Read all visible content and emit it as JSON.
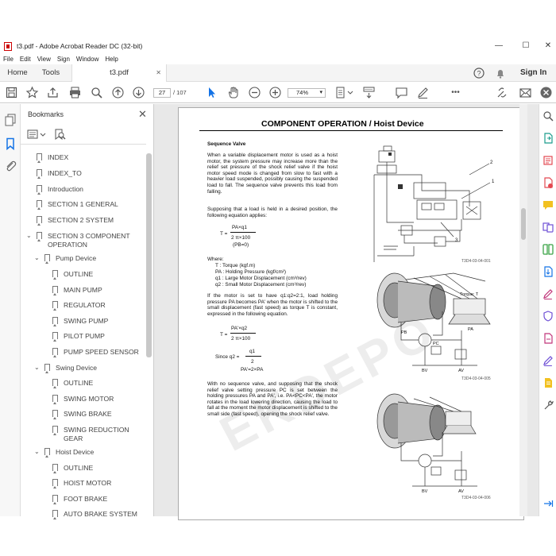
{
  "window": {
    "title": "t3.pdf - Adobe Acrobat Reader DC (32-bit)",
    "minimize": "—",
    "maximize": "☐",
    "close": "✕"
  },
  "menu": [
    "File",
    "Edit",
    "View",
    "Sign",
    "Window",
    "Help"
  ],
  "tabs": {
    "home": "Home",
    "tools": "Tools",
    "doc": "t3.pdf",
    "doc_close": "✕",
    "sign_in": "Sign In"
  },
  "toolbar": {
    "page_current": "27",
    "page_total": "/ 107",
    "zoom": "74%"
  },
  "bookmarks": {
    "header": "Bookmarks",
    "close": "✕",
    "items": [
      {
        "label": "INDEX"
      },
      {
        "label": "INDEX_TO"
      },
      {
        "label": "Introduction"
      },
      {
        "label": "SECTION 1 GENERAL"
      },
      {
        "label": "SECTION 2 SYSTEM"
      },
      {
        "label": "SECTION 3 COMPONENT"
      },
      {
        "label": "OPERATION"
      },
      {
        "label": "Pump Device"
      },
      {
        "label": "OUTLINE"
      },
      {
        "label": "MAIN PUMP"
      },
      {
        "label": "REGULATOR"
      },
      {
        "label": "SWING PUMP"
      },
      {
        "label": "PILOT PUMP"
      },
      {
        "label": "PUMP SPEED SENSOR"
      },
      {
        "label": "Swing Device"
      },
      {
        "label": "OUTLINE"
      },
      {
        "label": "SWING MOTOR"
      },
      {
        "label": "SWING BRAKE"
      },
      {
        "label": "SWING REDUCTION"
      },
      {
        "label": "GEAR"
      },
      {
        "label": "Hoist Device"
      },
      {
        "label": "OUTLINE"
      },
      {
        "label": "HOIST MOTOR"
      },
      {
        "label": "FOOT BRAKE"
      },
      {
        "label": "AUTO BRAKE SYSTEM"
      }
    ]
  },
  "document": {
    "title": "COMPONENT OPERATION / Hoist Device",
    "section": "Sequence Valve",
    "para1": "When a variable displacement motor is used as a hoist motor, the system pressure may increase more than the relief set pressure of the shock relief valve if the hoist motor speed mode is changed from slow to fast with a heavier load suspended, possibly causing the suspended load to fall. The sequence valve prevents this load from falling.",
    "para2": "Supposing that a load is held in a desired position, the following equation applies:",
    "eq1_lhs": "T =",
    "eq1_num": "PA×q1",
    "eq1_den": "2 π×100",
    "eq1_note": "(PB=0)",
    "where": "Where:",
    "w1": "T   : Torque (kgf.m)",
    "w2": "PA : Holding Pressure (kgf/cm²)",
    "w3": "q1  : Large Motor Displacement (cm³/rev)",
    "w4": "q2  : Small Motor Displacement (cm³/rev)",
    "para3": "If the motor is set to have q1:q2=2:1, load holding pressure PA becomes PA' when the motor is shifted to the small displacement (fast speed) as torque T is constant, expressed in the following equation.",
    "eq2_lhs": "T =",
    "eq2_num": "PA'×q2",
    "eq2_den": "2 π×100",
    "eq3_lhs": "Since q2 =",
    "eq3_num": "q1",
    "eq3_den": "2",
    "eq3_res": "PA'=2×PA",
    "para4": "With no sequence valve, and supposing that the shock relief valve setting pressure PC is set between the holding pressures PA and PA', i.e. PA<PC<PA', the motor rotates in the load lowering direction, causing the load to fall at the moment the motor displacement is shifted to the small side (fast speed), opening the shock relief valve.",
    "fig1_label1": "2",
    "fig1_label2": "1",
    "fig1_label3": "3",
    "fig1_id": "T3D4-03-04-001",
    "fig2_torque": "Torque: T",
    "fig2_pb": "PB",
    "fig2_pa": "PA",
    "fig2_pc": "PC",
    "fig2_bv": "BV",
    "fig2_av": "AV",
    "fig2_id": "T3D4-03-04-005",
    "fig3_bv": "BV",
    "fig3_av": "AV",
    "fig3_id": "T3D4-03-04-006"
  },
  "watermark": "EKDEPO"
}
